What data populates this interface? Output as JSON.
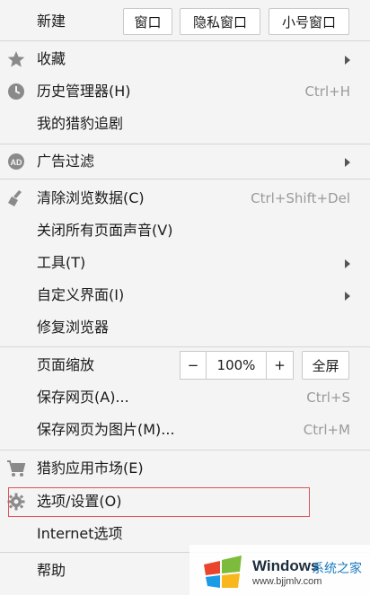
{
  "top": {
    "new_label": "新建",
    "buttons": [
      "窗口",
      "隐私窗口",
      "小号窗口"
    ]
  },
  "section1": [
    {
      "label": "收藏",
      "icon": "star-icon",
      "submenu": true
    },
    {
      "label": "历史管理器(H)",
      "icon": "clock-icon",
      "shortcut": "Ctrl+H"
    },
    {
      "label": "我的猎豹追剧"
    }
  ],
  "section2": [
    {
      "label": "广告过滤",
      "icon": "ad-icon",
      "submenu": true
    }
  ],
  "section3": [
    {
      "label": "清除浏览数据(C)",
      "icon": "broom-icon",
      "shortcut": "Ctrl+Shift+Del"
    },
    {
      "label": "关闭所有页面声音(V)"
    },
    {
      "label": "工具(T)",
      "submenu": true
    },
    {
      "label": "自定义界面(I)",
      "submenu": true
    },
    {
      "label": "修复浏览器"
    }
  ],
  "section4": {
    "zoom_label": "页面缩放",
    "zoom_minus": "−",
    "zoom_value": "100%",
    "zoom_plus": "+",
    "fullscreen": "全屏",
    "items": [
      {
        "label": "保存网页(A)...",
        "shortcut": "Ctrl+S"
      },
      {
        "label": "保存网页为图片(M)...",
        "shortcut": "Ctrl+M"
      }
    ]
  },
  "section5": [
    {
      "label": "猎豹应用市场(E)",
      "icon": "cart-icon"
    },
    {
      "label": "选项/设置(O)",
      "icon": "gear-icon"
    },
    {
      "label": "Internet选项"
    }
  ],
  "section6": [
    {
      "label": "帮助"
    }
  ],
  "watermark": {
    "brand": "Windows",
    "tagline": "系统之家",
    "url": "www.bjjmlv.com"
  },
  "colors": {
    "background": "#f4f4f4",
    "highlight_border": "#e0525a",
    "icon_gray": "#8a8a8a"
  }
}
